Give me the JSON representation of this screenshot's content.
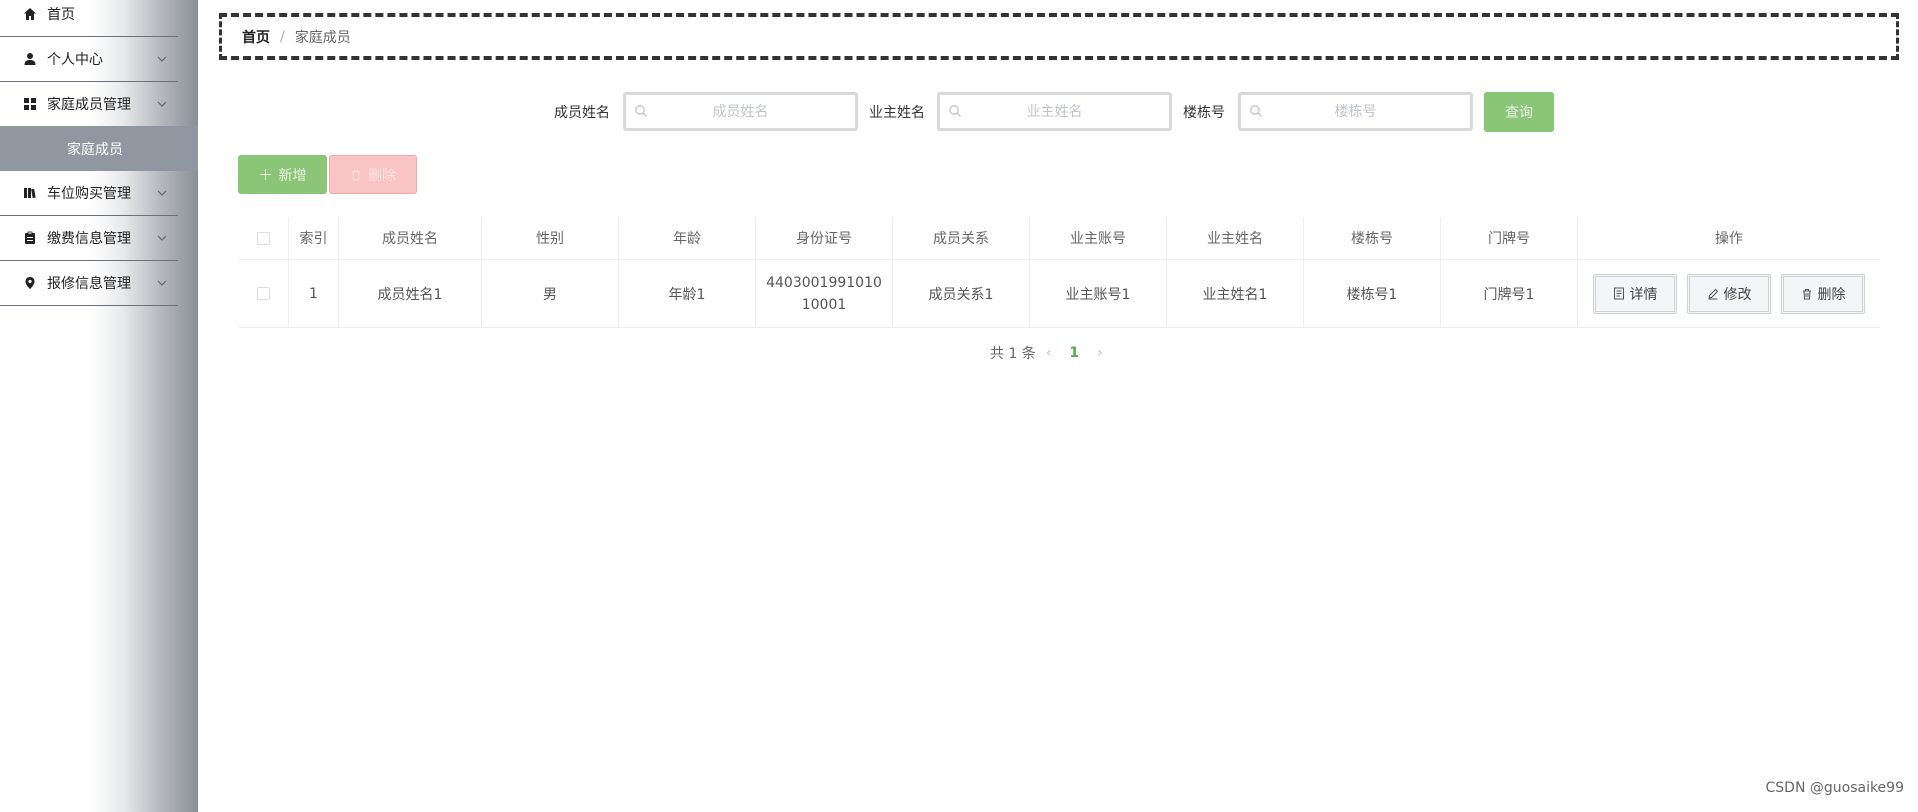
{
  "sidebar": {
    "items": [
      {
        "label": "首页",
        "icon": "home-icon",
        "has_arrow": false
      },
      {
        "label": "个人中心",
        "icon": "user-icon",
        "has_arrow": true
      },
      {
        "label": "家庭成员管理",
        "icon": "grid-icon",
        "has_arrow": true
      },
      {
        "label": "车位购买管理",
        "icon": "book-icon",
        "has_arrow": true
      },
      {
        "label": "缴费信息管理",
        "icon": "clipboard-icon",
        "has_arrow": true
      },
      {
        "label": "报修信息管理",
        "icon": "pin-icon",
        "has_arrow": true
      }
    ],
    "active_sub": "家庭成员"
  },
  "breadcrumb": {
    "home": "首页",
    "separator": "/",
    "current": "家庭成员"
  },
  "search": {
    "member_name_label": "成员姓名",
    "member_name_placeholder": "成员姓名",
    "owner_name_label": "业主姓名",
    "owner_name_placeholder": "业主姓名",
    "building_label": "楼栋号",
    "building_placeholder": "楼栋号",
    "query_label": "查询"
  },
  "actions": {
    "add_label": "新增",
    "delete_label": "删除"
  },
  "table": {
    "headers": [
      "索引",
      "成员姓名",
      "性别",
      "年龄",
      "身份证号",
      "成员关系",
      "业主账号",
      "业主姓名",
      "楼栋号",
      "门牌号",
      "操作"
    ],
    "rows": [
      {
        "index": "1",
        "member_name": "成员姓名1",
        "gender": "男",
        "age": "年龄1",
        "id_card": "440300199101010001",
        "relation": "成员关系1",
        "owner_account": "业主账号1",
        "owner_name": "业主姓名1",
        "building": "楼栋号1",
        "door": "门牌号1"
      }
    ],
    "op_buttons": {
      "detail": "详情",
      "edit": "修改",
      "delete": "删除"
    }
  },
  "pagination": {
    "total_text": "共 1 条",
    "current_page": "1"
  },
  "watermark": "CSDN @guosaike99",
  "colors": {
    "accent_green": "#8bc578",
    "danger_light": "#fbc4c4",
    "active_sub_bg": "#9097a0",
    "page_active": "#4caf50"
  }
}
